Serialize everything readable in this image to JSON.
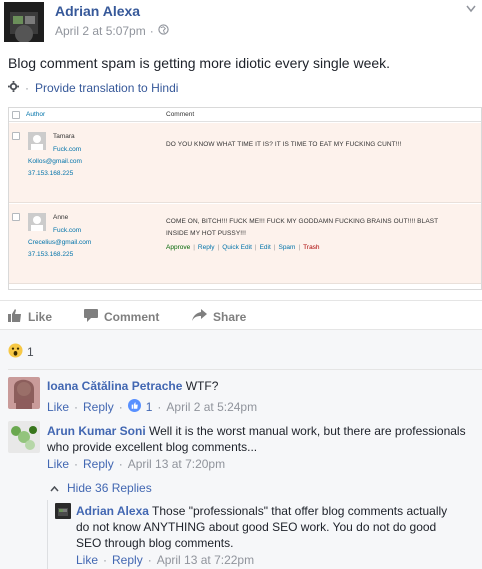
{
  "post": {
    "author": "Adrian Alexa",
    "timestamp": "April 2 at 5:07pm",
    "dot": "·",
    "text": "Blog comment spam is getting more idiotic every single week.",
    "translate": "Provide translation to Hindi"
  },
  "shot": {
    "col_author": "Author",
    "col_comment": "Comment",
    "rows": [
      {
        "name": "Tamara",
        "site": "Fuck.com",
        "email": "Kollos@gmail.com",
        "ip": "37.153.168.225",
        "comment": "DO YOU KNOW WHAT TIME IT IS? IT IS TIME TO EAT MY FUCKING CUNT!!!"
      },
      {
        "name": "Anne",
        "site": "Fuck.com",
        "email": "Crecelius@gmail.com",
        "ip": "37.153.168.225",
        "comment_line1": "COME ON, BITCH!!! FUCK ME!!! FUCK MY GODDAMN FUCKING BRAINS OUT!!!! BLAST",
        "comment_line2": "INSIDE MY HOT PUSSY!!!",
        "row_actions": [
          "Approve",
          "Reply",
          "Quick Edit",
          "Edit",
          "Spam",
          "Trash"
        ],
        "sep": "|"
      }
    ]
  },
  "actions": {
    "like": "Like",
    "comment": "Comment",
    "share": "Share"
  },
  "reactions": {
    "count": "1"
  },
  "comments": [
    {
      "author": "Ioana Cătălina Petrache",
      "text": "WTF?",
      "like": "Like",
      "reply": "Reply",
      "likes": "1",
      "time": "April 2 at 5:24pm"
    },
    {
      "author": "Arun Kumar Soni",
      "text_line1": "Well it is the worst manual work, but there are professionals",
      "text_line2": "who provide excellent blog comments...",
      "like": "Like",
      "reply": "Reply",
      "time": "April 13 at 7:20pm",
      "hide_replies": "Hide 36 Replies"
    },
    {
      "author": "Adrian Alexa",
      "text_line1": "Those \"professionals\" that offer blog comments actually",
      "text_line2": "do not know ANYTHING about good SEO work. You do not do good",
      "text_line3": "SEO through blog comments.",
      "like": "Like",
      "reply": "Reply",
      "time": "April 13 at 7:22pm"
    }
  ],
  "sep": "·",
  "colors": {
    "link": "#365899",
    "muted": "#90949c",
    "spam_row": "#fdf2ec",
    "gray_bg": "#f6f7f9"
  }
}
